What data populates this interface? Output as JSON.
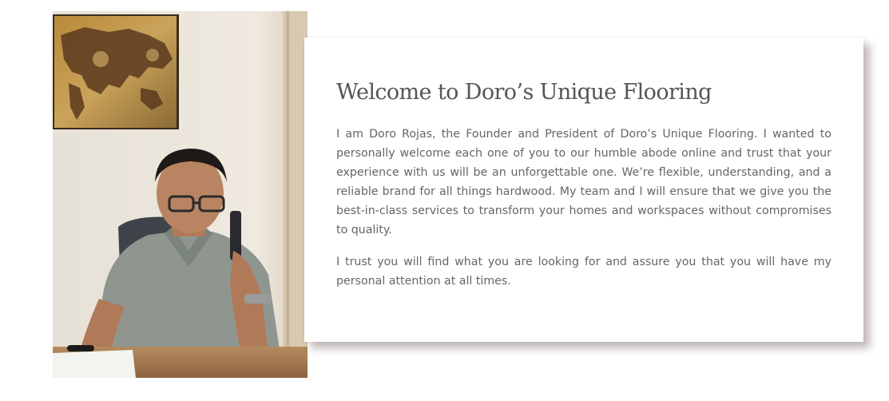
{
  "welcome": {
    "heading": "Welcome to Doro’s Unique Flooring",
    "paragraphs": [
      "I am Doro Rojas, the Founder and President of Doro’s Unique Flooring. I wanted to personally welcome each one of you to our humble abode online and trust that your experience with us will be an unforgettable one. We’re flexible, understanding, and a reliable brand for all things hardwood. My team and I will ensure that we give you the best-in-class services to transform your homes and workspaces without compromises to quality.",
      "I trust you will find what you are looking for and assure you that you will have my personal attention at all times."
    ]
  },
  "colors": {
    "heading": "#555555",
    "body_text": "#666666",
    "wall": "#ece6dd",
    "shirt": "#8f9690",
    "frame": "#4a3a2a"
  }
}
